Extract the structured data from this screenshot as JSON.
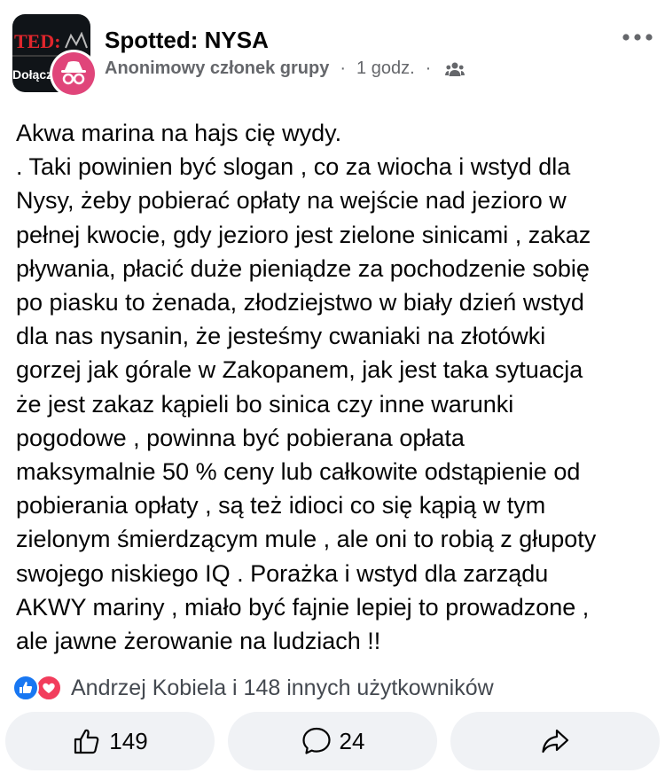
{
  "group": {
    "name": "Spotted: NYSA",
    "avatar_text_top": "TED:",
    "avatar_text_bottom": "Dołącz"
  },
  "post_meta": {
    "author": "Anonimowy członek grupy",
    "separator": "·",
    "time": "1 godz.",
    "audience_icon": "group-people-icon"
  },
  "post": {
    "lines": [
      "Akwa marina na hajs cię wydy.",
      ". Taki powinien być slogan , co za wiocha i wstyd dla",
      "Nysy, żeby pobierać opłaty na wejście nad jezioro w",
      "pełnej kwocie, gdy jezioro jest zielone sinicami , zakaz",
      "pływania, płacić duże pieniądze za pochodzenie sobię",
      "po piasku to żenada, złodziejstwo w biały dzień wstyd",
      "dla nas nysanin, że jesteśmy cwaniaki na złotówki",
      "gorzej jak górale w Zakopanem, jak jest taka sytuacja",
      "że jest zakaz kąpieli bo sinica czy inne warunki",
      "pogodowe , powinna być pobierana opłata",
      "maksymalnie 50 % ceny lub całkowite odstąpienie od",
      "pobierania opłaty , są też idioci co się kąpią w tym",
      "zielonym śmierdzącym mule , ale oni to robią z głupoty",
      "swojego niskiego IQ . Porażka i wstyd dla zarządu",
      "AKWY mariny , miało być fajnie lepiej to prowadzone ,",
      "ale jawne żerowanie na ludziach !!"
    ]
  },
  "reactions": {
    "summary": "Andrzej Kobiela i 148 innych użytkowników",
    "types": [
      "like",
      "love"
    ],
    "like_color": "#1877f2",
    "love_color": "#f23d5c"
  },
  "actions": {
    "like_count": "149",
    "comment_count": "24",
    "share_icon": "share-arrow-icon"
  },
  "colors": {
    "secondary_text": "#65676b",
    "button_bg": "#f0f2f5",
    "anon_avatar": "#e0457a"
  }
}
